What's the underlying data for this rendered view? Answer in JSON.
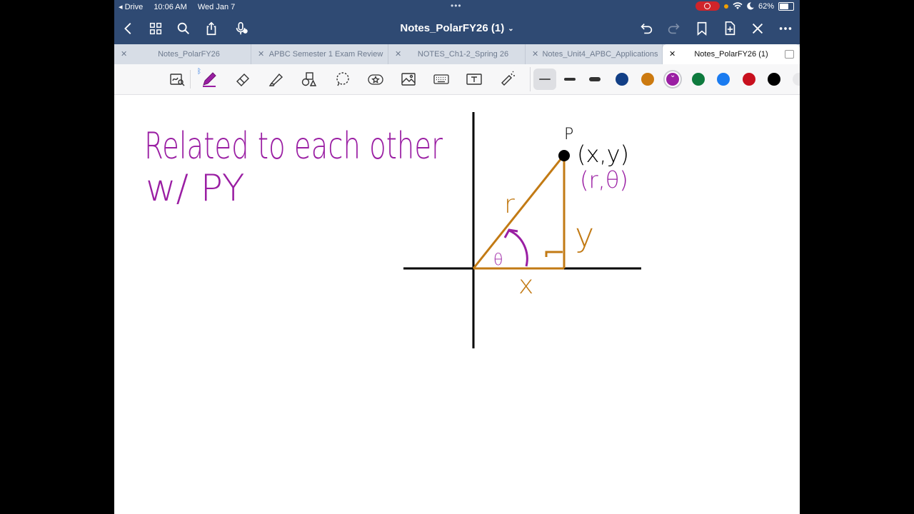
{
  "status": {
    "app": "Drive",
    "time": "10:06 AM",
    "date": "Wed Jan 7",
    "battery": "62%",
    "dots": "•••"
  },
  "navbar": {
    "title": "Notes_PolarFY26 (1)"
  },
  "tabs": [
    {
      "label": "Notes_PolarFY26",
      "active": false
    },
    {
      "label": "APBC Semester 1 Exam Review",
      "active": false
    },
    {
      "label": "NOTES_Ch1-2_Spring 26",
      "active": false
    },
    {
      "label": "Notes_Unit4_APBC_Applications",
      "active": false
    },
    {
      "label": "Notes_PolarFY26 (1)",
      "active": true
    }
  ],
  "toolbar": {
    "bluetooth": "ᛒ",
    "colors": [
      "#123f86",
      "#cc7a10",
      "#9a1ea3",
      "#0e7a3e",
      "#1a7bf0",
      "#c8101e",
      "#000000"
    ],
    "selected_color": "#9a1ea3"
  },
  "canvas": {
    "line1": "Related to each other",
    "line2": "w/ PY",
    "point_label": "P",
    "cartesian": "(x,y)",
    "polar": "(r,θ)",
    "r_label": "r",
    "y_label": "y",
    "x_label": "x",
    "theta_label": "θ",
    "ink_purple": "#9a1ea3",
    "ink_orange": "#c27a14"
  }
}
